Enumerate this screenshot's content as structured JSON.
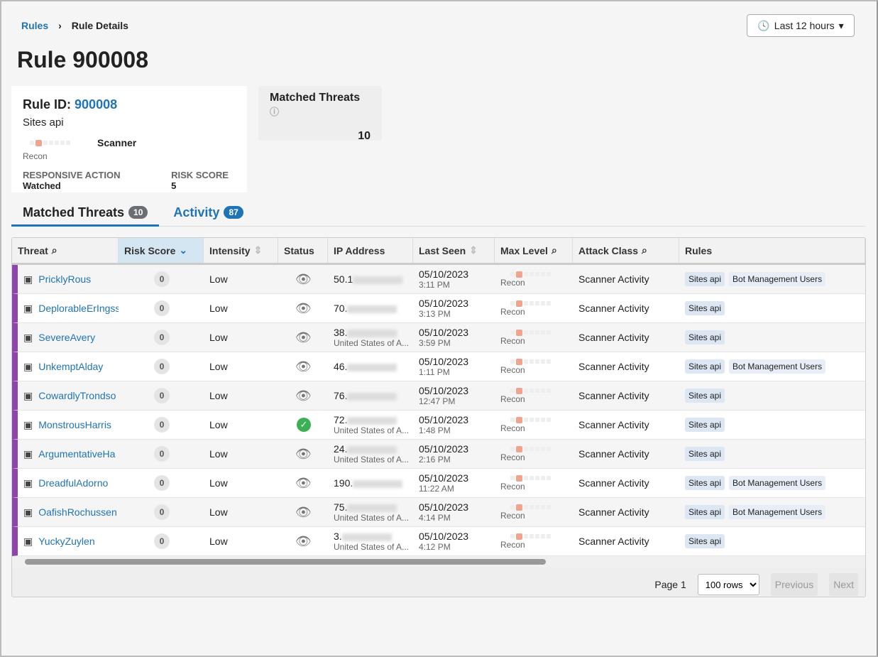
{
  "breadcrumb": {
    "root": "Rules",
    "current": "Rule Details"
  },
  "time_filter": "Last 12 hours",
  "title": "Rule 900008",
  "card": {
    "rule_id_label": "Rule ID:",
    "rule_id": "900008",
    "name": "Sites api",
    "level": "Recon",
    "level_value": 1,
    "attack": "Scanner",
    "action_label": "RESPONSIVE ACTION",
    "action": "Watched",
    "risk_label": "RISK SCORE",
    "risk": "5"
  },
  "matched": {
    "label": "Matched Threats",
    "value": "10"
  },
  "tabs": [
    {
      "label": "Matched Threats",
      "count": "10"
    },
    {
      "label": "Activity",
      "count": "87"
    }
  ],
  "columns": [
    "Threat",
    "Risk Score",
    "Intensity",
    "Status",
    "IP Address",
    "Last Seen",
    "Max Level",
    "Attack Class",
    "Rules"
  ],
  "rows": [
    {
      "threat": "PricklyRous",
      "risk": "0",
      "intensity": "Low",
      "status": "watched",
      "ip": "50.1",
      "country": "",
      "date": "05/10/2023",
      "time": "3:11 PM",
      "level": "Recon",
      "attack": "Scanner Activity",
      "rules": [
        "Sites api",
        "Bot Management Users"
      ]
    },
    {
      "threat": "DeplorableErIngss",
      "risk": "0",
      "intensity": "Low",
      "status": "watched",
      "ip": "70.",
      "country": "",
      "date": "05/10/2023",
      "time": "3:13 PM",
      "level": "Recon",
      "attack": "Scanner Activity",
      "rules": [
        "Sites api"
      ]
    },
    {
      "threat": "SevereAvery",
      "risk": "0",
      "intensity": "Low",
      "status": "watched",
      "ip": "38.",
      "country": "United States of A...",
      "date": "05/10/2023",
      "time": "3:59 PM",
      "level": "Recon",
      "attack": "Scanner Activity",
      "rules": [
        "Sites api"
      ]
    },
    {
      "threat": "UnkemptAlday",
      "risk": "0",
      "intensity": "Low",
      "status": "watched",
      "ip": "46.",
      "country": "",
      "date": "05/10/2023",
      "time": "1:11 PM",
      "level": "Recon",
      "attack": "Scanner Activity",
      "rules": [
        "Sites api",
        "Bot Management Users"
      ]
    },
    {
      "threat": "CowardlyTrondso",
      "risk": "0",
      "intensity": "Low",
      "status": "watched",
      "ip": "76.",
      "country": "",
      "date": "05/10/2023",
      "time": "12:47 PM",
      "level": "Recon",
      "attack": "Scanner Activity",
      "rules": [
        "Sites api"
      ]
    },
    {
      "threat": "MonstrousHarris",
      "risk": "0",
      "intensity": "Low",
      "status": "resolved",
      "ip": "72.",
      "country": "United States of A...",
      "date": "05/10/2023",
      "time": "1:48 PM",
      "level": "Recon",
      "attack": "Scanner Activity",
      "rules": [
        "Sites api"
      ]
    },
    {
      "threat": "ArgumentativeHa",
      "risk": "0",
      "intensity": "Low",
      "status": "watched",
      "ip": "24.",
      "country": "United States of A...",
      "date": "05/10/2023",
      "time": "2:16 PM",
      "level": "Recon",
      "attack": "Scanner Activity",
      "rules": [
        "Sites api"
      ]
    },
    {
      "threat": "DreadfulAdorno",
      "risk": "0",
      "intensity": "Low",
      "status": "watched",
      "ip": "190.",
      "country": "",
      "date": "05/10/2023",
      "time": "11:22 AM",
      "level": "Recon",
      "attack": "Scanner Activity",
      "rules": [
        "Sites api",
        "Bot Management Users"
      ]
    },
    {
      "threat": "OafishRochussen",
      "risk": "0",
      "intensity": "Low",
      "status": "watched",
      "ip": "75.",
      "country": "United States of A...",
      "date": "05/10/2023",
      "time": "4:14 PM",
      "level": "Recon",
      "attack": "Scanner Activity",
      "rules": [
        "Sites api",
        "Bot Management Users"
      ]
    },
    {
      "threat": "YuckyZuylen",
      "risk": "0",
      "intensity": "Low",
      "status": "watched",
      "ip": "3.",
      "country": "United States of A...",
      "date": "05/10/2023",
      "time": "4:12 PM",
      "level": "Recon",
      "attack": "Scanner Activity",
      "rules": [
        "Sites api"
      ]
    }
  ],
  "pager": {
    "page": "Page 1",
    "rows": "100 rows",
    "prev": "Previous",
    "next": "Next"
  },
  "colors": {
    "accent": "#1f73b7",
    "row_marker": "#8e44ad",
    "level": "#f0a48e",
    "ok": "#3cb054"
  }
}
